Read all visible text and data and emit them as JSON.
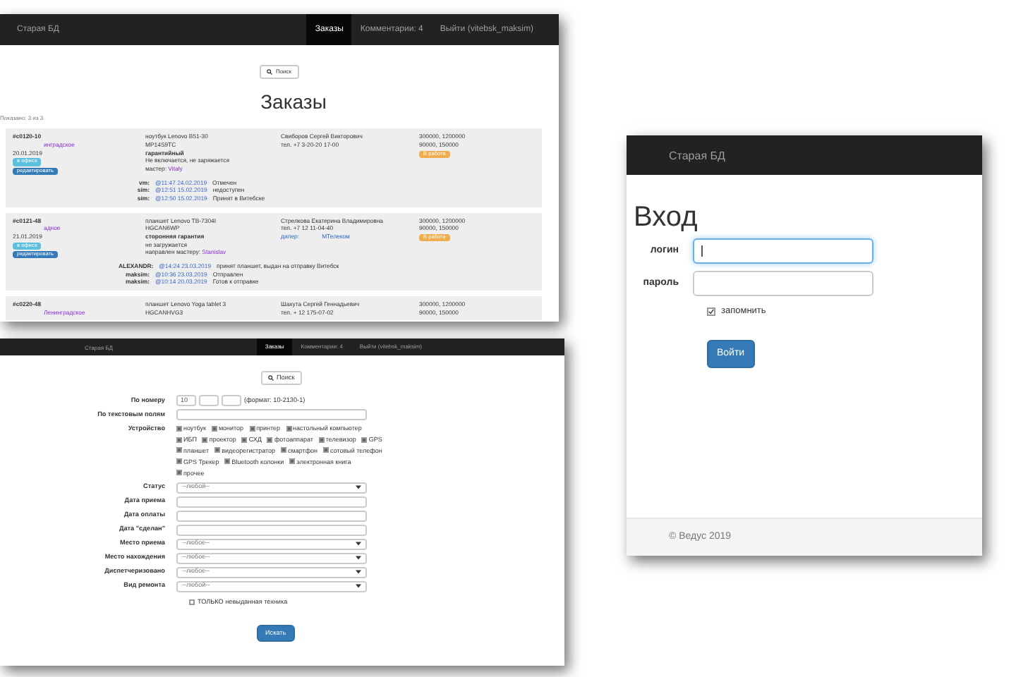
{
  "orders_window": {
    "brand": "Старая БД",
    "nav": [
      {
        "label": "Заказы",
        "selected": true
      },
      {
        "label": "Комментарии: 4",
        "selected": false
      },
      {
        "label": "Выйти (vitebsk_maksim)",
        "selected": false
      }
    ],
    "search_button": "Поиск",
    "title": "Заказы",
    "count": "Показано: 3 из 3",
    "orders": [
      {
        "number": "#с0120-10",
        "city": "инградское",
        "date": "20.01.2019",
        "labels": [
          {
            "text": "в офисе",
            "color": "#5bc0de"
          },
          {
            "text": "редактировать",
            "color": "#337ab7"
          }
        ],
        "device": [
          "ноутбук Lenovo B51-30",
          "MP14S9TC"
        ],
        "repair_type": "гарантийный",
        "notes": [
          "Не включается, не заряжается"
        ],
        "master": {
          "label": "мастер:",
          "name": "Vitaly"
        },
        "client": "Свиборов Сергей Викторович",
        "phone": "тел. +7  3-20-20  17-00",
        "prices": [
          "300000, 1200000",
          "90000, 150000"
        ],
        "status": {
          "text": "В работе",
          "color": "#f0ad4e"
        },
        "comments": [
          {
            "author": "vm:",
            "time": "@11:47 24.02.2019",
            "text": "Отмечен"
          },
          {
            "author": "sim:",
            "time": "@12:51 15.02.2019",
            "text": "недоступен"
          },
          {
            "author": "sim:",
            "time": "@12:50 15.02.2019",
            "text": "Принят в Витебске"
          }
        ]
      },
      {
        "number": "#с0121-48",
        "city": "адное",
        "date": "21.01.2019",
        "labels": [
          {
            "text": "в офисе",
            "color": "#5bc0de"
          },
          {
            "text": "редактировать",
            "color": "#337ab7"
          }
        ],
        "device": [
          "планшет Lenovo TB-7304I",
          "HGCAN6WP"
        ],
        "repair_type": "сторонняя гарантия",
        "notes": [
          "не загружается"
        ],
        "master": {
          "label": "направлен мастеру:",
          "name": "Stanislav"
        },
        "client": "Стрелкова Екатерина Владимировна",
        "phone": "тел. +7  12  11-04-40",
        "dealer": {
          "label": "дилер:",
          "name": "МТелеком"
        },
        "prices": [
          "300000, 1200000",
          "90000, 150000"
        ],
        "status": {
          "text": "В работе",
          "color": "#f0ad4e"
        },
        "comments": [
          {
            "author": "ALEXANDR:",
            "time": "@14:24 23.03.2019",
            "text": "принят планшет, выдан на отправку Витебск"
          },
          {
            "author": "maksim:",
            "time": "@10:36 23.03.2019",
            "text": "Отправлен"
          },
          {
            "author": "maksim:",
            "time": "@10:14 20.03.2019",
            "text": "Готов к отправке"
          }
        ]
      },
      {
        "number": "#с0220-48",
        "city": "Ленинградское",
        "device": [
          "планшет Lenovo Yoga tablet 3",
          "HGCANHVG3"
        ],
        "client": "Шахута Сергей Геннадьевич",
        "phone": "тел. +  12  175-07-02",
        "prices": [
          "300000, 1200000",
          "90000, 150000"
        ]
      }
    ]
  },
  "search_window": {
    "brand": "Старая БД",
    "nav": [
      {
        "label": "Заказы",
        "selected": true
      },
      {
        "label": "Комментарии: 4",
        "selected": false
      },
      {
        "label": "Выйти (vitebsk_maksim)",
        "selected": false
      }
    ],
    "search_link": "Поиск",
    "number_row": {
      "label": "По номеру",
      "fields": [
        {
          "kind": "filled",
          "value": "10"
        },
        {
          "kind": "blank"
        },
        {
          "kind": "blank"
        }
      ],
      "hint": "(формат: 10-2130-1)"
    },
    "rows": [
      {
        "kind": "text",
        "label": "По текстовым полям"
      },
      {
        "kind": "checks",
        "label": "Устройство",
        "options": [
          {
            "text": "ноутбук",
            "checked": true
          },
          {
            "text": "монитор",
            "checked": true
          },
          {
            "text": "принтер",
            "checked": true
          },
          {
            "text": "настольный компьютер",
            "checked": true
          },
          {
            "text": "ИБП",
            "checked": true
          },
          {
            "text": "проектор",
            "checked": true
          },
          {
            "text": "СХД",
            "checked": true
          },
          {
            "text": "фотоаппарат",
            "checked": true
          },
          {
            "text": "телевизор",
            "checked": true
          },
          {
            "text": "GPS",
            "checked": true
          },
          {
            "text": "планшет",
            "checked": true
          },
          {
            "text": "видеорегистратор",
            "checked": true
          },
          {
            "text": "смартфон",
            "checked": true
          },
          {
            "text": "сотовый телефон",
            "checked": true
          },
          {
            "text": "GPS Трекер",
            "checked": true
          },
          {
            "text": "Bluetooth колонки",
            "checked": true
          },
          {
            "text": "электронная книга",
            "checked": true
          },
          {
            "text": "прочее",
            "checked": true
          }
        ]
      },
      {
        "kind": "select",
        "label": "Статус",
        "value": "--любой--"
      },
      {
        "kind": "text",
        "label": "Дата приема"
      },
      {
        "kind": "text",
        "label": "Дата оплаты"
      },
      {
        "kind": "text",
        "label": "Дата \"сделан\""
      },
      {
        "kind": "select",
        "label": "Место приема",
        "value": "--любое--"
      },
      {
        "kind": "select",
        "label": "Место нахождения",
        "value": "--любое--"
      },
      {
        "kind": "select",
        "label": "Диспетчеризовано",
        "value": "--любое--"
      },
      {
        "kind": "select",
        "label": "Вид ремонта",
        "value": "--любой--"
      }
    ],
    "only_checkbox": {
      "label": "ТОЛЬКО невыданная техника",
      "checked": false
    },
    "submit": "Искать"
  },
  "login_window": {
    "brand": "Старая БД",
    "title": "Вход",
    "fields": [
      {
        "label": "логин",
        "focused": true
      },
      {
        "label": "пароль",
        "focused": false
      }
    ],
    "remember": {
      "label": "запомнить",
      "checked": true
    },
    "submit": "Войти",
    "footer": "© Ведус 2019"
  }
}
